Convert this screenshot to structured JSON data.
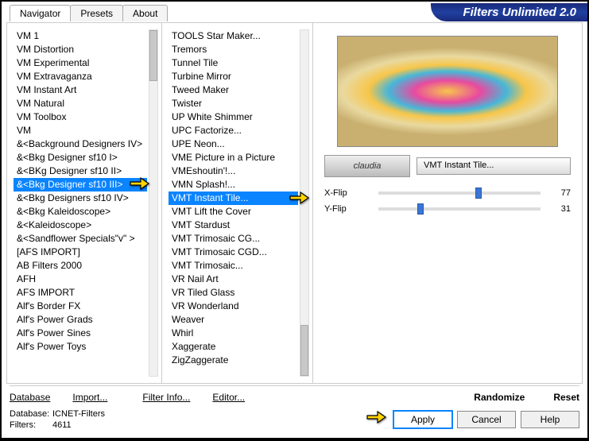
{
  "title": "Filters Unlimited 2.0",
  "tabs": [
    "Navigator",
    "Presets",
    "About"
  ],
  "activeTab": 0,
  "categories": [
    "VM 1",
    "VM Distortion",
    "VM Experimental",
    "VM Extravaganza",
    "VM Instant Art",
    "VM Natural",
    "VM Toolbox",
    "VM",
    "&<Background Designers IV>",
    "&<Bkg Designer sf10 I>",
    "&<BKg Designer sf10 II>",
    "&<Bkg Designer sf10 III>",
    "&<Bkg Designers sf10 IV>",
    "&<Bkg Kaleidoscope>",
    "&<Kaleidoscope>",
    "&<Sandflower Specials\"v\" >",
    "[AFS IMPORT]",
    "AB Filters 2000",
    "AFH",
    "AFS IMPORT",
    "Alf's Border FX",
    "Alf's Power Grads",
    "Alf's Power Sines",
    "Alf's Power Toys"
  ],
  "selectedCategory": 11,
  "filters": [
    "TOOLS Star Maker...",
    "Tremors",
    "Tunnel Tile",
    "Turbine Mirror",
    "Tweed Maker",
    "Twister",
    "UP White Shimmer",
    "UPC Factorize...",
    "UPE Neon...",
    "VME Picture in a Picture",
    "VMEshoutin'!...",
    "VMN Splash!...",
    "VMT Instant Tile...",
    "VMT Lift the Cover",
    "VMT Stardust",
    "VMT Trimosaic CG...",
    "VMT Trimosaic CGD...",
    "VMT Trimosaic...",
    "VR Nail Art",
    "VR Tiled Glass",
    "VR Wonderland",
    "Weaver",
    "Whirl",
    "Xaggerate",
    "ZigZaggerate"
  ],
  "selectedFilter": 12,
  "logo": "claudia",
  "filterName": "VMT Instant Tile...",
  "params": [
    {
      "label": "X-Flip",
      "value": 77,
      "pos": 60
    },
    {
      "label": "Y-Flip",
      "value": 31,
      "pos": 24
    }
  ],
  "bottomButtons": {
    "database": "Database",
    "import": "Import...",
    "filterInfo": "Filter Info...",
    "editor": "Editor...",
    "randomize": "Randomize",
    "reset": "Reset"
  },
  "footer": {
    "dbLabel": "Database:",
    "dbValue": "ICNET-Filters",
    "filtersLabel": "Filters:",
    "filtersValue": "4611"
  },
  "buttons": {
    "apply": "Apply",
    "cancel": "Cancel",
    "help": "Help"
  }
}
